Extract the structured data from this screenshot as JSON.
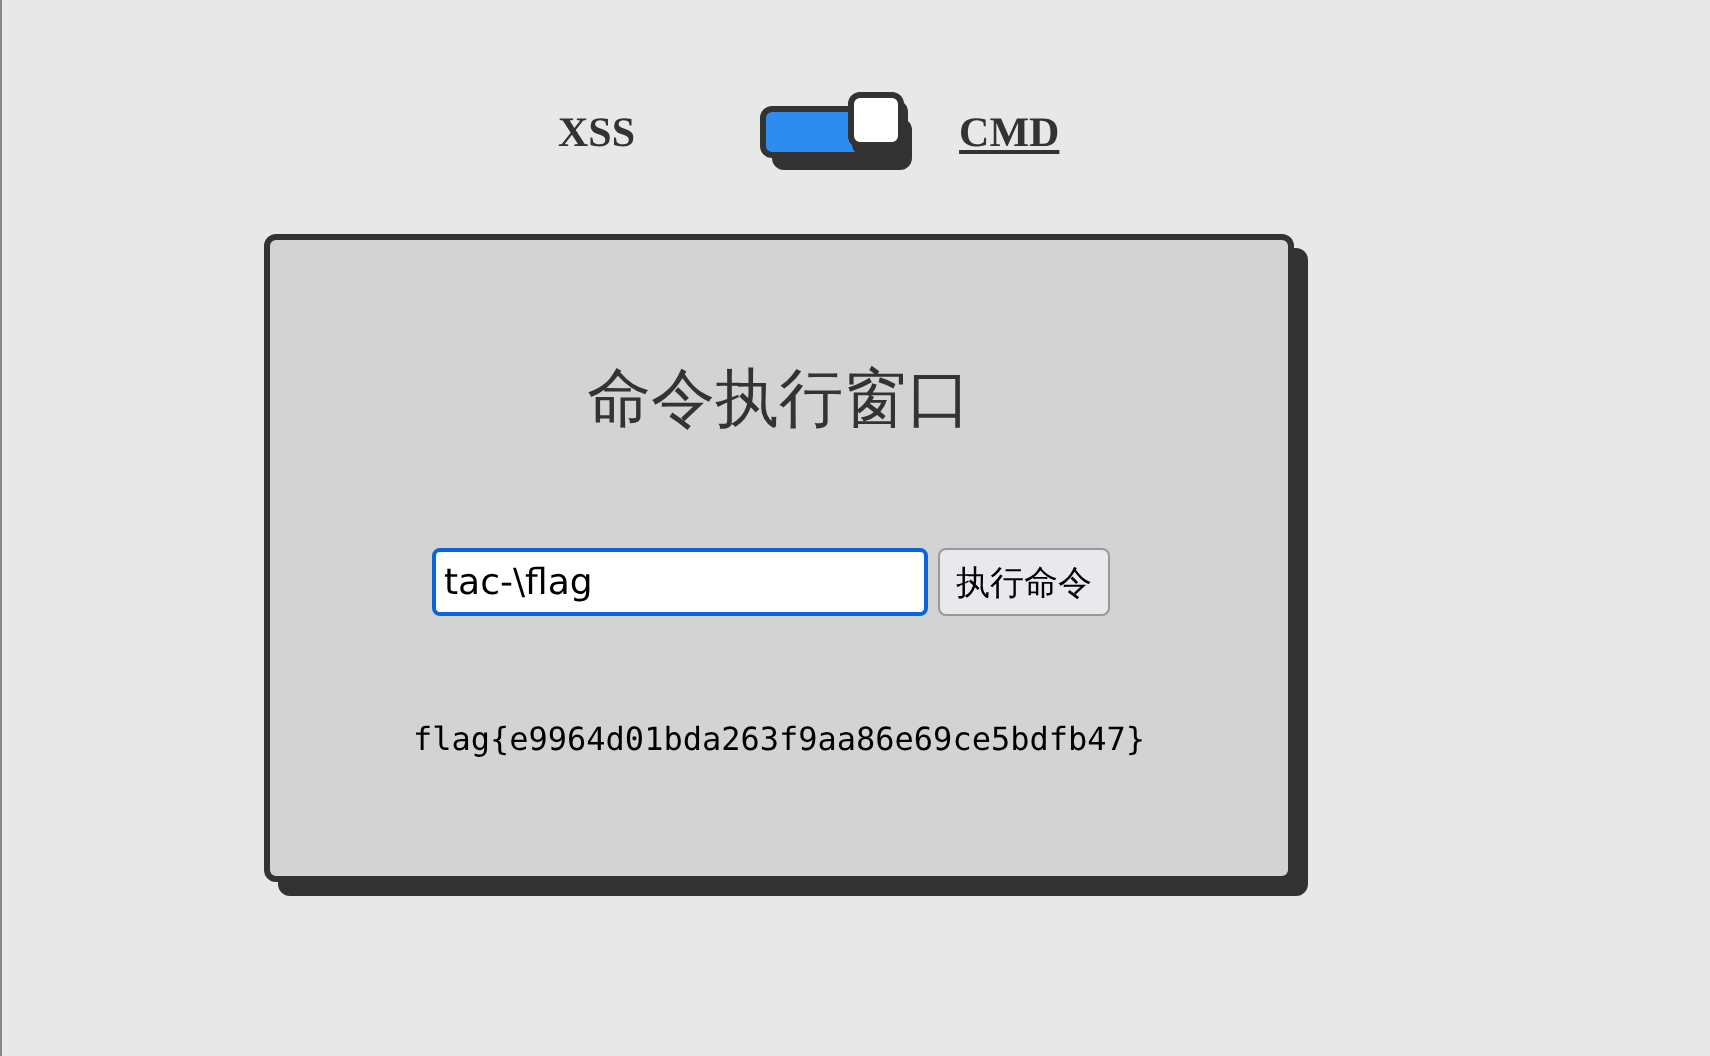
{
  "modes": [
    {
      "label": "XSS",
      "selected": false
    },
    {
      "label": "CMD",
      "selected": true
    }
  ],
  "mode_switch": {
    "on": true
  },
  "panel": {
    "title": "命令执行窗口",
    "command_field": {
      "value": "tac-\\flag"
    },
    "run_button": "执行命令",
    "output": "flag{e9964d01bda263f9aa86e69ce5bdfb47}"
  }
}
